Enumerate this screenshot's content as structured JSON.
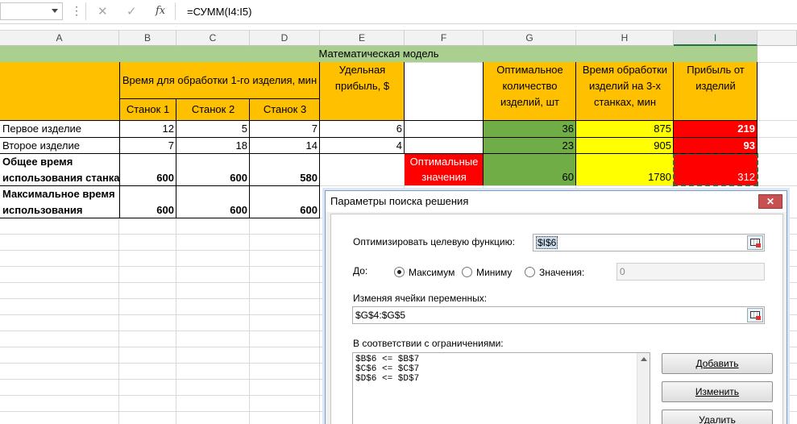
{
  "formula_bar": {
    "name_box": "",
    "dots": "⋮",
    "cancel_glyph": "✕",
    "enter_glyph": "✓",
    "fx_label": "fx",
    "formula": "=СУММ(I4:I5)"
  },
  "columns": [
    "A",
    "B",
    "C",
    "D",
    "E",
    "F",
    "G",
    "H",
    "I"
  ],
  "sheet": {
    "title": "Математическая модель",
    "header_time": "Время для обработки 1-го изделия, мин",
    "machine1": "Станок 1",
    "machine2": "Станок 2",
    "machine3": "Станок 3",
    "unit_profit": "Удельная прибыль, $",
    "optimal_qty": "Оптимальное количество изделий, шт",
    "process_time": "Время обработки изделий на 3-х станках, мин",
    "profit": "Прибыль от изделий",
    "row1_label": "Первое изделие",
    "row1": [
      "12",
      "5",
      "7",
      "6",
      "36",
      "875",
      "219"
    ],
    "row2_label": "Второе изделие",
    "row2": [
      "7",
      "18",
      "14",
      "4",
      "23",
      "905",
      "93"
    ],
    "row3_label_line1": "Общее время",
    "row3_label_line2": "использования станка",
    "row3": [
      "600",
      "600",
      "580"
    ],
    "optimal_label_line1": "Оптимальные",
    "optimal_label_line2": "значения",
    "optimal_values": [
      "60",
      "1780",
      "312"
    ],
    "row4_label_line1": "Максимальное время",
    "row4_label_line2": "использования",
    "row4": [
      "600",
      "600",
      "600"
    ]
  },
  "dialog": {
    "title": "Параметры поиска решения",
    "close_glyph": "✕",
    "objective_label": "Оптимизировать целевую функцию:",
    "objective_value": "$I$6",
    "to_label": "До:",
    "opt_max": "Максимум",
    "opt_min": "Миниму",
    "opt_value": "Значения:",
    "value_field": "0",
    "vars_label": "Изменяя ячейки переменных:",
    "vars_value": "$G$4:$G$5",
    "constraints_label": "В соответствии с ограничениями:",
    "constraints": [
      "$B$6 <= $B$7",
      "$C$6 <= $C$7",
      "$D$6 <= $D$7"
    ],
    "btn_add": "Добавить",
    "btn_change": "Изменить",
    "btn_delete": "Удалить"
  },
  "colors": {
    "orange": "#ffc000",
    "green": "#70ad47",
    "title_green": "#a9d08e",
    "yellow": "#ffff00",
    "red": "#ff0000",
    "excel_green": "#217346"
  }
}
